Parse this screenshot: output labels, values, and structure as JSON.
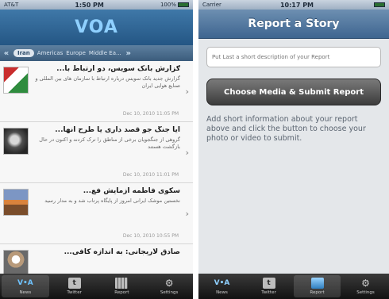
{
  "left_phone": {
    "status": {
      "carrier": "AT&T",
      "time": "1:50 PM",
      "battery": "100%"
    },
    "logo": {
      "prefix": "VO",
      "suffix": "A"
    },
    "categories": [
      {
        "label": "Iran"
      },
      {
        "label": "Americas"
      },
      {
        "label": "Europe"
      },
      {
        "label": "Middle Ea..."
      }
    ],
    "news": [
      {
        "headline": "ګزارش بانک سویس، دو ارتباط با...",
        "summary": "گزارش جدید بانک سویس درباره ارتباط با سازمان های بین المللی و صنایع هوایی ایران",
        "stamp": "Dec 10, 2010  11:05 PM"
      },
      {
        "headline": "آیا جنگ جو قصد داری یا طرح انها...",
        "summary": "گروهی از جنگجویان برخی از مناطق را ترک کردند و اکنون در حال بازگشت هستند",
        "stamp": "Dec 10, 2010  11:01 PM"
      },
      {
        "headline": "سکوی فاطمه آزمایش فع...",
        "summary": "نخستین موشک ایرانی امروز از پایگاه پرتاب شد و به مدار رسید",
        "stamp": "Dec 10, 2010  10:55 PM"
      },
      {
        "headline": "صادق لاریجانی: به اندازه کافی...",
        "summary": "",
        "stamp": ""
      }
    ],
    "tabs": [
      {
        "label": "News",
        "icon": "voa-logo-icon"
      },
      {
        "label": "Twitter",
        "icon": "twitter-icon"
      },
      {
        "label": "Report",
        "icon": "film-icon"
      },
      {
        "label": "Settings",
        "icon": "gear-icon"
      }
    ]
  },
  "right_phone": {
    "status": {
      "carrier": "Carrier",
      "time": "10:17 PM"
    },
    "title": "Report a Story",
    "input_placeholder": "Put Last a short description of your Report",
    "submit_label": "Choose Media & Submit Report",
    "instructions": "Add short information about your report above and click the button to choose your photo or video to submit.",
    "tabs": [
      {
        "label": "News",
        "icon": "voa-logo-icon"
      },
      {
        "label": "Twitter",
        "icon": "twitter-icon"
      },
      {
        "label": "Report",
        "icon": "photo-icon"
      },
      {
        "label": "Settings",
        "icon": "gear-icon"
      }
    ]
  },
  "colors": {
    "brand_blue": "#245684",
    "tab_highlight": "#6ec3ff"
  }
}
